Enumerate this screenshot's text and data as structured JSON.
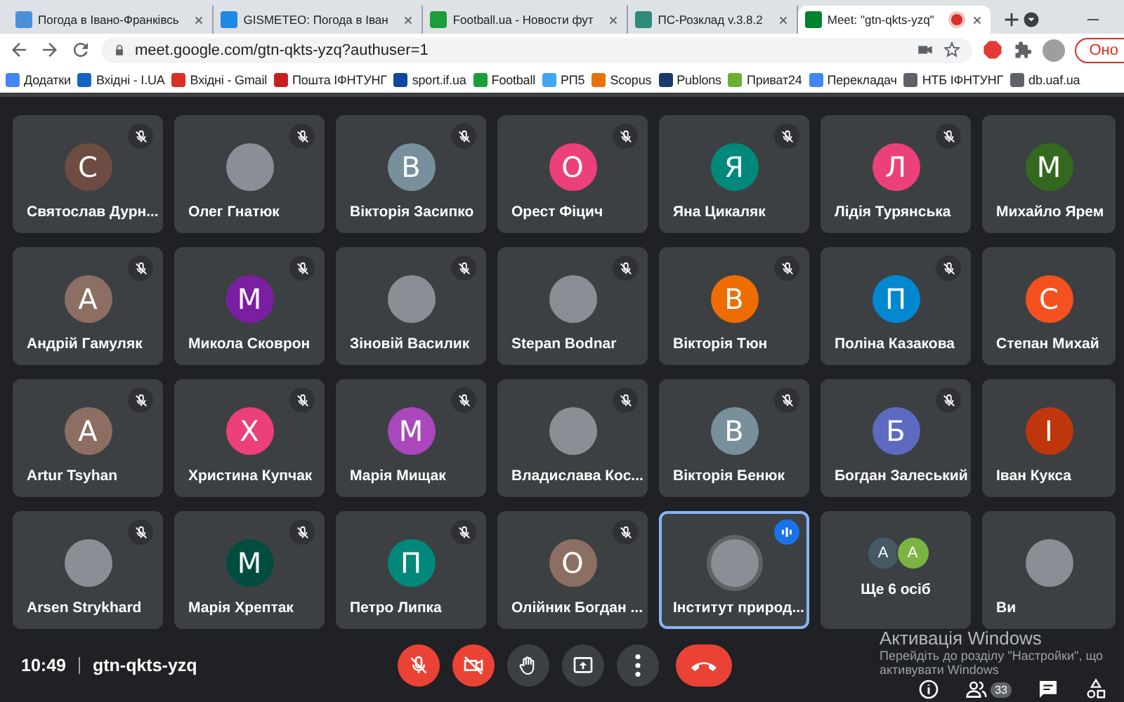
{
  "browser": {
    "tabs": [
      {
        "title": "Погода в Івано-Франківсь",
        "color": "#4a8fd9",
        "selected": false,
        "recording": false
      },
      {
        "title": "GISMETEO: Погода в Іван",
        "color": "#1e88e5",
        "selected": false,
        "recording": false
      },
      {
        "title": "Football.ua - Новости фут",
        "color": "#1b9e3a",
        "selected": false,
        "recording": false
      },
      {
        "title": "ПС-Розклад v.3.8.2",
        "color": "#2e8b7a",
        "selected": false,
        "recording": false
      },
      {
        "title": "Meet: \"gtn-qkts-yzq\"",
        "color": "#00832d",
        "selected": true,
        "recording": true
      }
    ],
    "address": "meet.google.com/gtn-qkts-yzq?authuser=1",
    "update_button": "Оно",
    "bookmarks": [
      {
        "label": "Додатки",
        "color": "#4285f4"
      },
      {
        "label": "Вхідні - I.UA",
        "color": "#1565c0"
      },
      {
        "label": "Вхідні - Gmail",
        "color": "#d93025"
      },
      {
        "label": "Пошта ІФНТУНГ",
        "color": "#c5221f"
      },
      {
        "label": "sport.if.ua",
        "color": "#0d47a1"
      },
      {
        "label": "Football",
        "color": "#1b9e3a"
      },
      {
        "label": "РП5",
        "color": "#42a5f5"
      },
      {
        "label": "Scopus",
        "color": "#e8710a"
      },
      {
        "label": "Publons",
        "color": "#1a3a6b"
      },
      {
        "label": "Приват24",
        "color": "#6aaf2f"
      },
      {
        "label": "Перекладач",
        "color": "#4285f4"
      },
      {
        "label": "НТБ ІФНТУНГ",
        "color": "#5f6368"
      },
      {
        "label": "db.uaf.ua",
        "color": "#5f6368"
      }
    ]
  },
  "tiles": [
    {
      "name": "Святослав Дурн...",
      "kind": "letter",
      "initial": "С",
      "color": "#6d4c41",
      "muted": true,
      "speaking": false
    },
    {
      "name": "Олег Гнатюк",
      "kind": "photo",
      "muted": true,
      "speaking": false
    },
    {
      "name": "Вікторія Засипко",
      "kind": "letter",
      "initial": "В",
      "color": "#78909c",
      "muted": true,
      "speaking": false
    },
    {
      "name": "Орест Фіцич",
      "kind": "letter",
      "initial": "О",
      "color": "#ec407a",
      "muted": true,
      "speaking": false
    },
    {
      "name": "Яна Цикаляк",
      "kind": "letter",
      "initial": "Я",
      "color": "#00897b",
      "muted": true,
      "speaking": false
    },
    {
      "name": "Лідія Турянська",
      "kind": "letter",
      "initial": "Л",
      "color": "#ec407a",
      "muted": true,
      "speaking": false
    },
    {
      "name": "Михайло Ярем",
      "kind": "letter",
      "initial": "М",
      "color": "#33691e",
      "muted": false,
      "speaking": false
    },
    {
      "name": "Андрій Гамуляк",
      "kind": "letter",
      "initial": "А",
      "color": "#8d6e63",
      "muted": true,
      "speaking": false
    },
    {
      "name": "Микола Сковрон",
      "kind": "letter",
      "initial": "М",
      "color": "#7b1fa2",
      "muted": true,
      "speaking": false
    },
    {
      "name": "Зіновій Василик",
      "kind": "photo",
      "muted": true,
      "speaking": false
    },
    {
      "name": "Stepan Bodnar",
      "kind": "photo",
      "muted": true,
      "speaking": false
    },
    {
      "name": "Вікторія Тюн",
      "kind": "letter",
      "initial": "В",
      "color": "#ef6c00",
      "muted": true,
      "speaking": false
    },
    {
      "name": "Поліна Казакова",
      "kind": "letter",
      "initial": "П",
      "color": "#0288d1",
      "muted": true,
      "speaking": false
    },
    {
      "name": "Степан Михай",
      "kind": "letter",
      "initial": "С",
      "color": "#f4511e",
      "muted": false,
      "speaking": false
    },
    {
      "name": "Artur Tsyhan",
      "kind": "letter",
      "initial": "А",
      "color": "#8d6e63",
      "muted": true,
      "speaking": false
    },
    {
      "name": "Христина Купчак",
      "kind": "letter",
      "initial": "Х",
      "color": "#ec407a",
      "muted": true,
      "speaking": false
    },
    {
      "name": "Марія Мищак",
      "kind": "letter",
      "initial": "М",
      "color": "#ab47bc",
      "muted": true,
      "speaking": false
    },
    {
      "name": "Владислава Кос...",
      "kind": "photo",
      "muted": true,
      "speaking": false
    },
    {
      "name": "Вікторія Бенюк",
      "kind": "letter",
      "initial": "В",
      "color": "#78909c",
      "muted": true,
      "speaking": false
    },
    {
      "name": "Богдан Залеський",
      "kind": "letter",
      "initial": "Б",
      "color": "#5c6bc0",
      "muted": true,
      "speaking": false
    },
    {
      "name": "Іван Кукса",
      "kind": "letter",
      "initial": "І",
      "color": "#bf360c",
      "muted": false,
      "speaking": false
    },
    {
      "name": "Arsen Strykhard",
      "kind": "photo",
      "muted": true,
      "speaking": false
    },
    {
      "name": "Марія Хрептак",
      "kind": "letter",
      "initial": "М",
      "color": "#004d40",
      "muted": true,
      "speaking": false
    },
    {
      "name": "Петро Липка",
      "kind": "letter",
      "initial": "П",
      "color": "#00897b",
      "muted": true,
      "speaking": false
    },
    {
      "name": "Олійник Богдан ...",
      "kind": "letter",
      "initial": "О",
      "color": "#8d6e63",
      "muted": true,
      "speaking": false
    },
    {
      "name": "Інститут природ...",
      "kind": "photo",
      "muted": false,
      "speaking": true
    },
    {
      "name": "Ще 6 осіб",
      "kind": "overflow",
      "avatars": [
        {
          "initial": "А",
          "color": "#455a64"
        },
        {
          "initial": "А",
          "color": "#7cb342"
        }
      ],
      "muted": false,
      "speaking": false
    },
    {
      "name": "Ви",
      "kind": "photo",
      "muted": false,
      "speaking": false
    }
  ],
  "toolbar": {
    "time": "10:49",
    "meeting_code": "gtn-qkts-yzq",
    "controls": [
      {
        "kind": "mic",
        "on": false
      },
      {
        "kind": "camera",
        "on": false
      },
      {
        "kind": "hand"
      },
      {
        "kind": "present"
      },
      {
        "kind": "more"
      },
      {
        "kind": "end"
      }
    ],
    "side": [
      {
        "kind": "info"
      },
      {
        "kind": "people",
        "badge": "33"
      },
      {
        "kind": "chat"
      },
      {
        "kind": "activities"
      }
    ]
  },
  "activation_notice": {
    "title": "Активація Windows",
    "lines": [
      "Перейдіть до розділу \"Настройки\", що",
      "активувати Windows"
    ]
  }
}
